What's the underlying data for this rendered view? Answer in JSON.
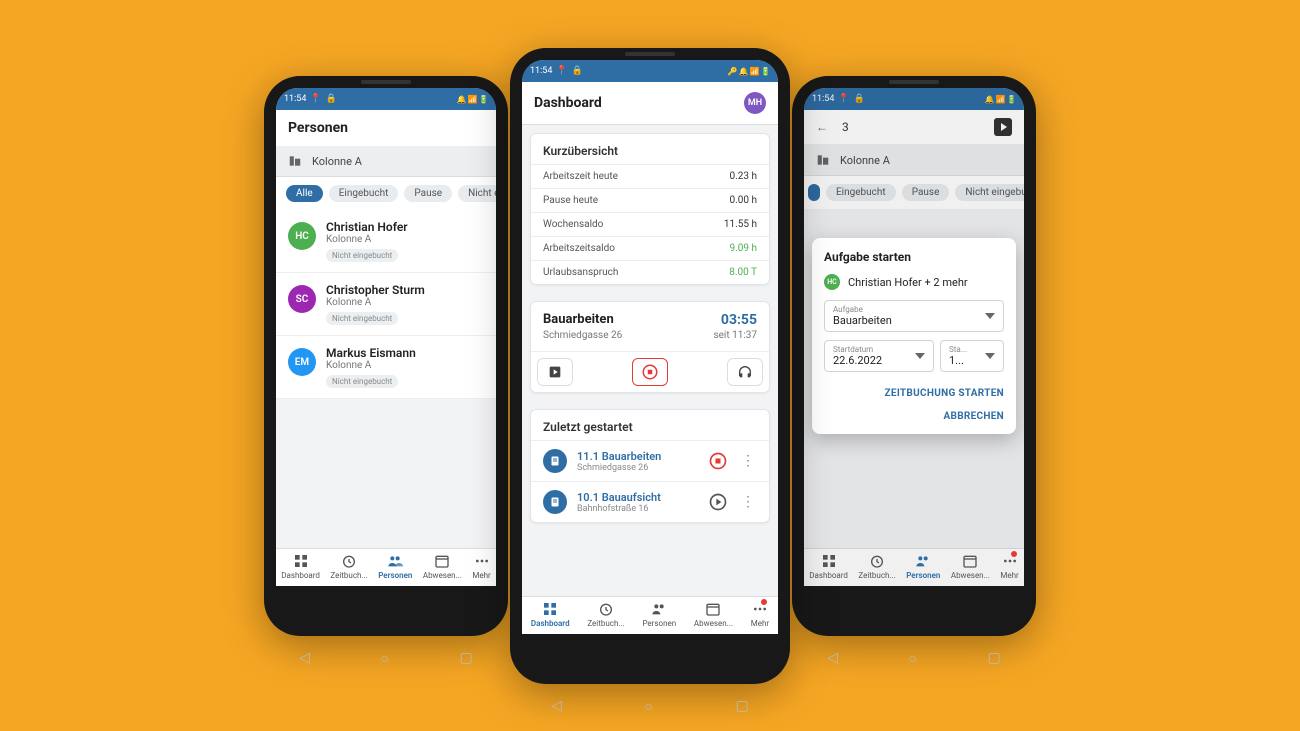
{
  "status": {
    "time": "11:54",
    "icons_right": "⚙ 📶 🔋"
  },
  "nav": {
    "dashboard": "Dashboard",
    "zeitbuch": "Zeitbuch...",
    "personen": "Personen",
    "abwesen": "Abwesen...",
    "mehr": "Mehr"
  },
  "left": {
    "title": "Personen",
    "group": "Kolonne A",
    "chips": {
      "alle": "Alle",
      "eingebucht": "Eingebucht",
      "pause": "Pause",
      "nicht": "Nicht eingeb..."
    },
    "persons": [
      {
        "initials": "HC",
        "name": "Christian Hofer",
        "sub": "Kolonne A",
        "badge": "Nicht eingebucht"
      },
      {
        "initials": "SC",
        "name": "Christopher Sturm",
        "sub": "Kolonne A",
        "badge": "Nicht eingebucht"
      },
      {
        "initials": "EM",
        "name": "Markus Eismann",
        "sub": "Kolonne A",
        "badge": "Nicht eingebucht"
      }
    ]
  },
  "center": {
    "title": "Dashboard",
    "avatar": "MH",
    "quick_title": "Kurzübersicht",
    "rows": {
      "r1l": "Arbeitszeit heute",
      "r1v": "0.23 h",
      "r2l": "Pause heute",
      "r2v": "0.00 h",
      "r3l": "Wochensaldo",
      "r3v": "11.55 h",
      "r4l": "Arbeitszeitsaldo",
      "r4v": "9.09 h",
      "r5l": "Urlaubsanspruch",
      "r5v": "8.00 T"
    },
    "task": {
      "title": "Bauarbeiten",
      "addr": "Schmiedgasse 26",
      "elapsed": "03:55",
      "since": "seit 11:37"
    },
    "recent_title": "Zuletzt gestartet",
    "recent": [
      {
        "name": "11.1 Bauarbeiten",
        "sub": "Schmiedgasse 26"
      },
      {
        "name": "10.1 Bauaufsicht",
        "sub": "Bahnhofstraße 16"
      }
    ]
  },
  "right": {
    "count": "3",
    "group": "Kolonne A",
    "chips": {
      "eingebucht": "Eingebucht",
      "pause": "Pause",
      "nicht": "Nicht eingebucht"
    },
    "modal": {
      "title": "Aufgabe starten",
      "user": "Christian Hofer + 2 mehr",
      "user_initials": "HC",
      "task_label": "Aufgabe",
      "task_value": "Bauarbeiten",
      "date_label": "Startdatum",
      "date_value": "22.6.2022",
      "time_label": "Sta...",
      "time_value": "1...",
      "action_start": "ZEITBUCHUNG STARTEN",
      "action_cancel": "ABBRECHEN"
    }
  }
}
